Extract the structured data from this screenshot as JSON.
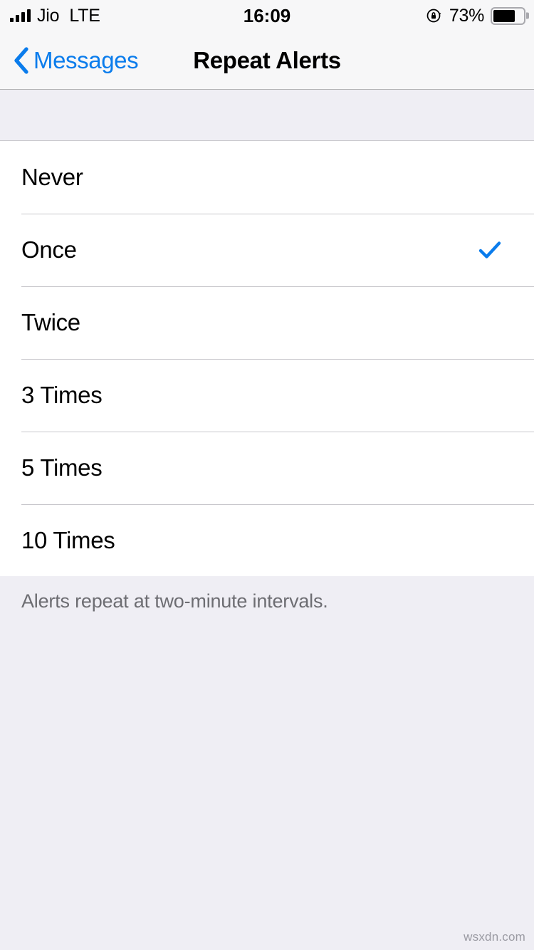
{
  "status_bar": {
    "carrier": "Jio",
    "network_type": "LTE",
    "time": "16:09",
    "battery_percent_label": "73%",
    "battery_level": 73,
    "signal_bars": 4,
    "rotation_lock_icon": "rotation-lock-icon",
    "battery_icon": "battery-icon"
  },
  "nav_bar": {
    "back_label": "Messages",
    "back_icon": "chevron-left-icon",
    "title": "Repeat Alerts"
  },
  "list": {
    "selected_value": "Once",
    "check_icon": "checkmark-icon",
    "rows": [
      {
        "label": "Never",
        "selected": false
      },
      {
        "label": "Once",
        "selected": true
      },
      {
        "label": "Twice",
        "selected": false
      },
      {
        "label": "3 Times",
        "selected": false
      },
      {
        "label": "5 Times",
        "selected": false
      },
      {
        "label": "10 Times",
        "selected": false
      }
    ]
  },
  "footer": {
    "note": "Alerts repeat at two-minute intervals."
  },
  "watermark": {
    "text": "wsxdn.com"
  },
  "colors": {
    "accent_blue": "#0a7cec",
    "background_gray": "#efeef4",
    "bar_background": "#f7f7f8",
    "row_background": "#ffffff",
    "separator": "#c8c7cc",
    "footer_text": "#6d6d72"
  }
}
